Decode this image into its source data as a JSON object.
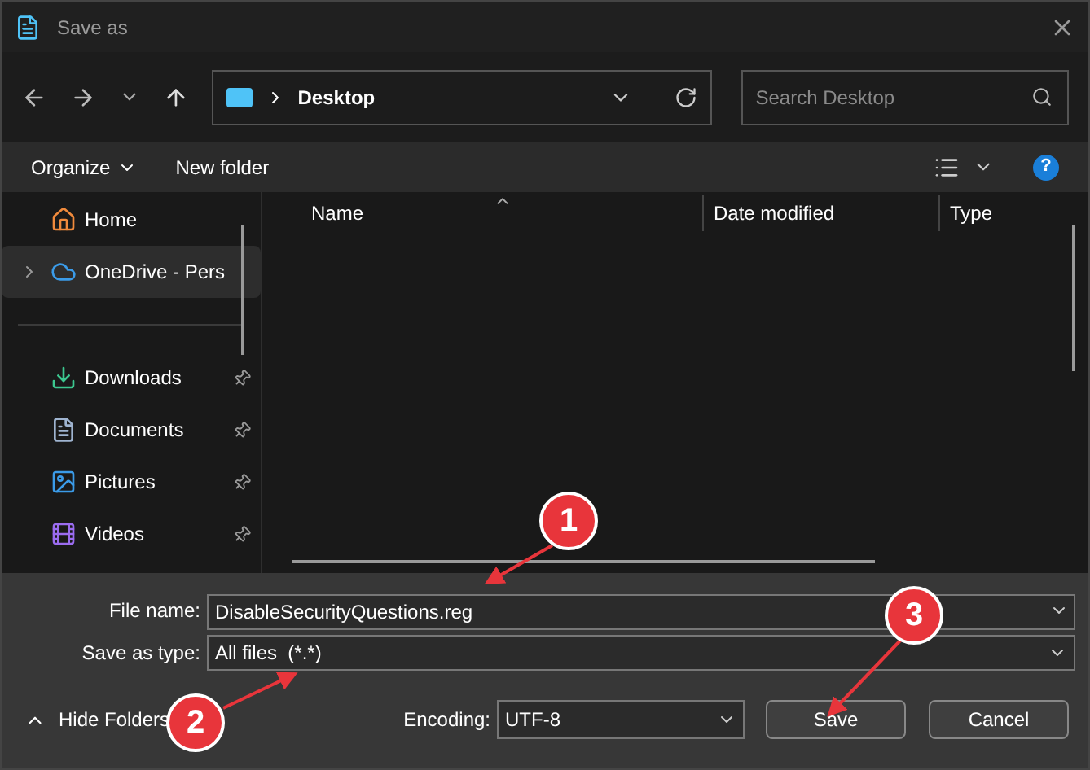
{
  "window": {
    "title": "Save as"
  },
  "address": {
    "location": "Desktop",
    "search_placeholder": "Search Desktop"
  },
  "toolbar": {
    "organize": "Organize",
    "new_folder": "New folder",
    "help": "?"
  },
  "sidebar": {
    "items": [
      {
        "label": "Home",
        "kind": "home",
        "selected": false,
        "pinned": false,
        "expandable": false
      },
      {
        "label": "OneDrive - Pers",
        "kind": "cloud",
        "selected": true,
        "pinned": false,
        "expandable": true
      },
      {
        "label": "Downloads",
        "kind": "download",
        "selected": false,
        "pinned": true,
        "expandable": false
      },
      {
        "label": "Documents",
        "kind": "document",
        "selected": false,
        "pinned": true,
        "expandable": false
      },
      {
        "label": "Pictures",
        "kind": "picture",
        "selected": false,
        "pinned": true,
        "expandable": false
      },
      {
        "label": "Videos",
        "kind": "video",
        "selected": false,
        "pinned": true,
        "expandable": false
      }
    ]
  },
  "table": {
    "columns": [
      "Name",
      "Date modified",
      "Type"
    ]
  },
  "form": {
    "file_name_label": "File name:",
    "file_name": "DisableSecurityQuestions.reg",
    "type_label": "Save as type:",
    "type": "All files  (*.*)",
    "encoding_label": "Encoding:",
    "encoding": "UTF-8"
  },
  "hide_folders": "Hide Folders",
  "buttons": [
    "Save",
    "Cancel"
  ],
  "annotations": [
    {
      "label": "1"
    },
    {
      "label": "2"
    },
    {
      "label": "3"
    }
  ]
}
